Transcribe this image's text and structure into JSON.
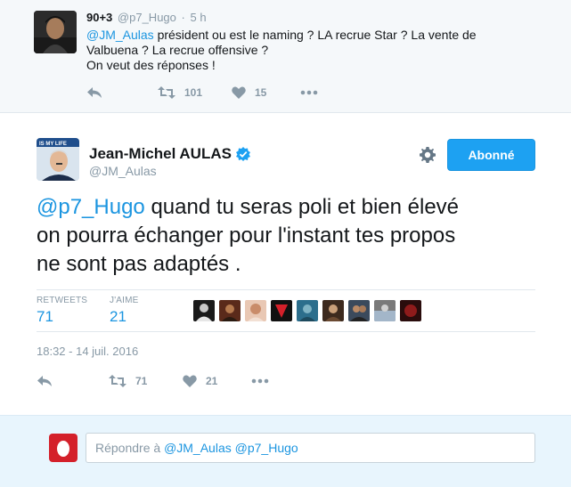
{
  "reply_tweet": {
    "author_name": "90+3",
    "author_handle": "@p7_Hugo",
    "dot": "·",
    "time": "5 h",
    "text_mention": "@JM_Aulas",
    "text_line1_rest": " président ou est le naming ? LA recrue Star ? La vente de",
    "text_line2": "Valbuena ? La recrue offensive ?",
    "text_line3": "On veut des réponses !",
    "retweets": "101",
    "likes": "15"
  },
  "main_tweet": {
    "author_name": "Jean-Michel AULAS",
    "author_handle": "@JM_Aulas",
    "avatar_banner_text": "IS MY LIFE",
    "follow_label": "Abonné",
    "text_mention": "@p7_Hugo",
    "text_line1_rest": " quand tu seras poli et bien élevé",
    "text_line2": "on pourra échanger pour l'instant tes propos",
    "text_line3": "ne sont pas adaptés .",
    "retweets_label": "RETWEETS",
    "retweets_value": "71",
    "likes_label": "J'AIME",
    "likes_value": "21",
    "timestamp": "18:32 - 14 juil. 2016",
    "action_retweets": "71",
    "action_likes": "21"
  },
  "reply_box": {
    "prefix": "Répondre à ",
    "mentions": "@JM_Aulas @p7_Hugo"
  },
  "icons": [
    "reply-icon",
    "retweet-icon",
    "heart-icon",
    "more-icon",
    "verified-icon",
    "gear-icon"
  ],
  "colors": {
    "accent": "#1da1f2",
    "link": "#1b95e0",
    "muted": "#8899a6",
    "reply_bg": "#e8f5fd",
    "top_bg": "#f5f8fa"
  }
}
